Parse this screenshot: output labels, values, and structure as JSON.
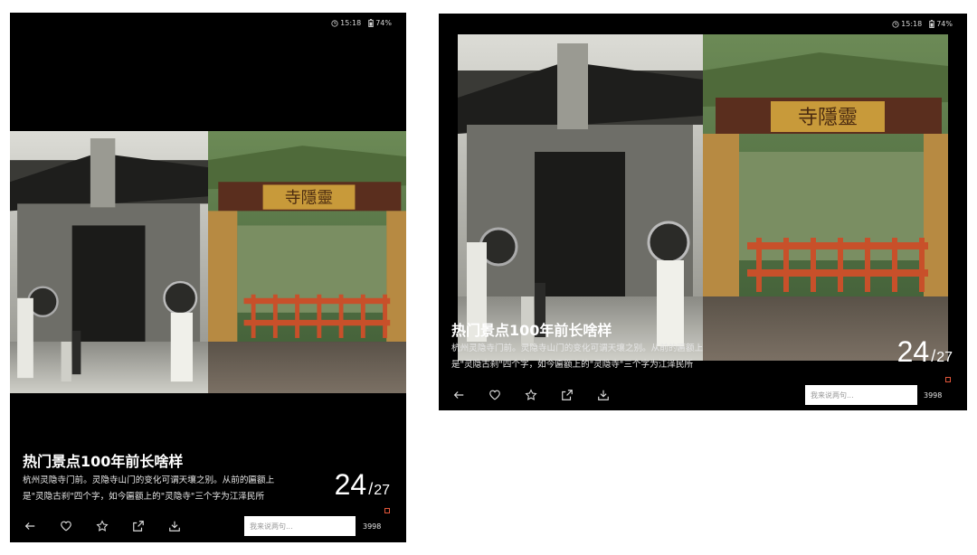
{
  "status": {
    "time": "15:18",
    "battery": "74%"
  },
  "caption": {
    "title": "热门景点100年前长啥样",
    "lines": [
      "杭州灵隐寺门前。灵隐寺山门的变化可谓天壤之别。从前的匾额上",
      "是\"灵隐古刹\"四个字，如今匾额上的\"灵隐寺\"三个字为江泽民所"
    ]
  },
  "counter": {
    "current": "24",
    "separator": "/",
    "total": "27"
  },
  "toolbar": {
    "icons": [
      "back-arrow-icon",
      "heart-icon",
      "star-icon",
      "share-icon",
      "download-icon"
    ],
    "comment_placeholder": "我来说两句...",
    "count": "3998"
  },
  "photo": {
    "sign_text": "寺隱靈",
    "colors": {
      "railing": "#c8502a",
      "roof_green": "#4f6a3a",
      "sign_gold": "#c89a3a"
    }
  }
}
